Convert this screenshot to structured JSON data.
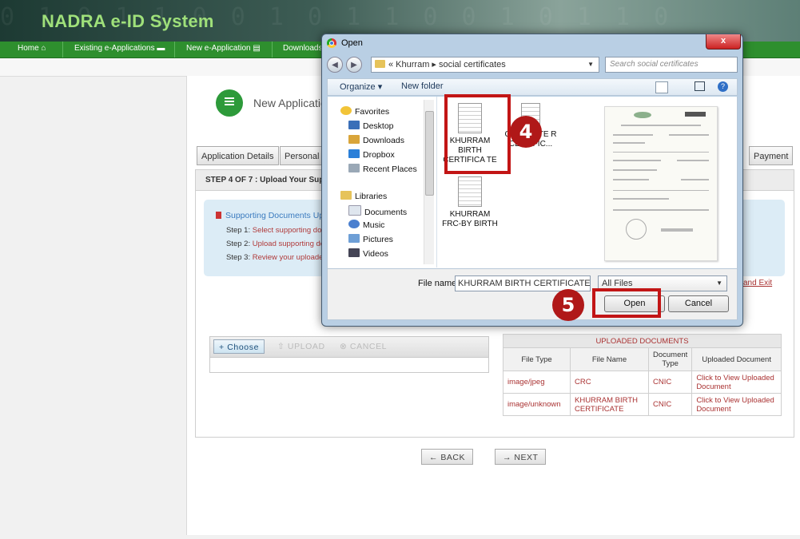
{
  "header": {
    "title": "NADRA e-ID System",
    "nav": [
      "Home",
      "Existing e-Applications",
      "New e-Application",
      "Downloads"
    ]
  },
  "page": {
    "title": "New Applicatio",
    "tabs": [
      "Application Details",
      "Personal D",
      "Payment"
    ],
    "step_header": "STEP 4 OF 7 : Upload Your Supp",
    "info": {
      "title": "Supporting Documents Up",
      "steps": [
        {
          "label": "Step 1:",
          "text": "Select supporting do"
        },
        {
          "label": "Step 2:",
          "text": "Upload supporting do"
        },
        {
          "label": "Step 3:",
          "text": "Review your uploade"
        }
      ]
    },
    "save_exit": "and Exit",
    "uploader": {
      "choose": "+ Choose",
      "upload": "⇧ UPLOAD",
      "cancel": "⊗ CANCEL"
    },
    "uploaded_docs": {
      "caption": "UPLOADED DOCUMENTS",
      "columns": [
        "File Type",
        "File Name",
        "Document Type",
        "Uploaded Document"
      ],
      "rows": [
        {
          "type": "image/jpeg",
          "name": "CRC",
          "doc_type": "CNIC",
          "link": "Click to View Uploaded Document"
        },
        {
          "type": "image/unknown",
          "name": "KHURRAM BIRTH CERTIFICATE",
          "doc_type": "CNIC",
          "link": "Click to View Uploaded Document"
        }
      ]
    },
    "back": "← BACK",
    "next": "→ NEXT"
  },
  "dialog": {
    "title": "Open",
    "close": "x",
    "path": "« Khurram ▸ social certificates",
    "search_placeholder": "Search social certificates",
    "organize": "Organize ▾",
    "new_folder": "New folder",
    "nav": {
      "favorites": "Favorites",
      "fav_items": [
        "Desktop",
        "Downloads",
        "Dropbox",
        "Recent Places"
      ],
      "libraries": "Libraries",
      "lib_items": [
        "Documents",
        "Music",
        "Pictures",
        "Videos"
      ]
    },
    "files": [
      "KHURRAM BIRTH CERTIFICA TE",
      "CHARACTE R CERTIFIC...",
      "KHURRAM FRC-BY BIRTH"
    ],
    "filename_label": "File name:",
    "filename_value": "KHURRAM BIRTH CERTIFICATE",
    "filter": "All Files",
    "open": "Open",
    "cancel": "Cancel"
  },
  "annotations": {
    "step4": "4",
    "step5": "5"
  }
}
